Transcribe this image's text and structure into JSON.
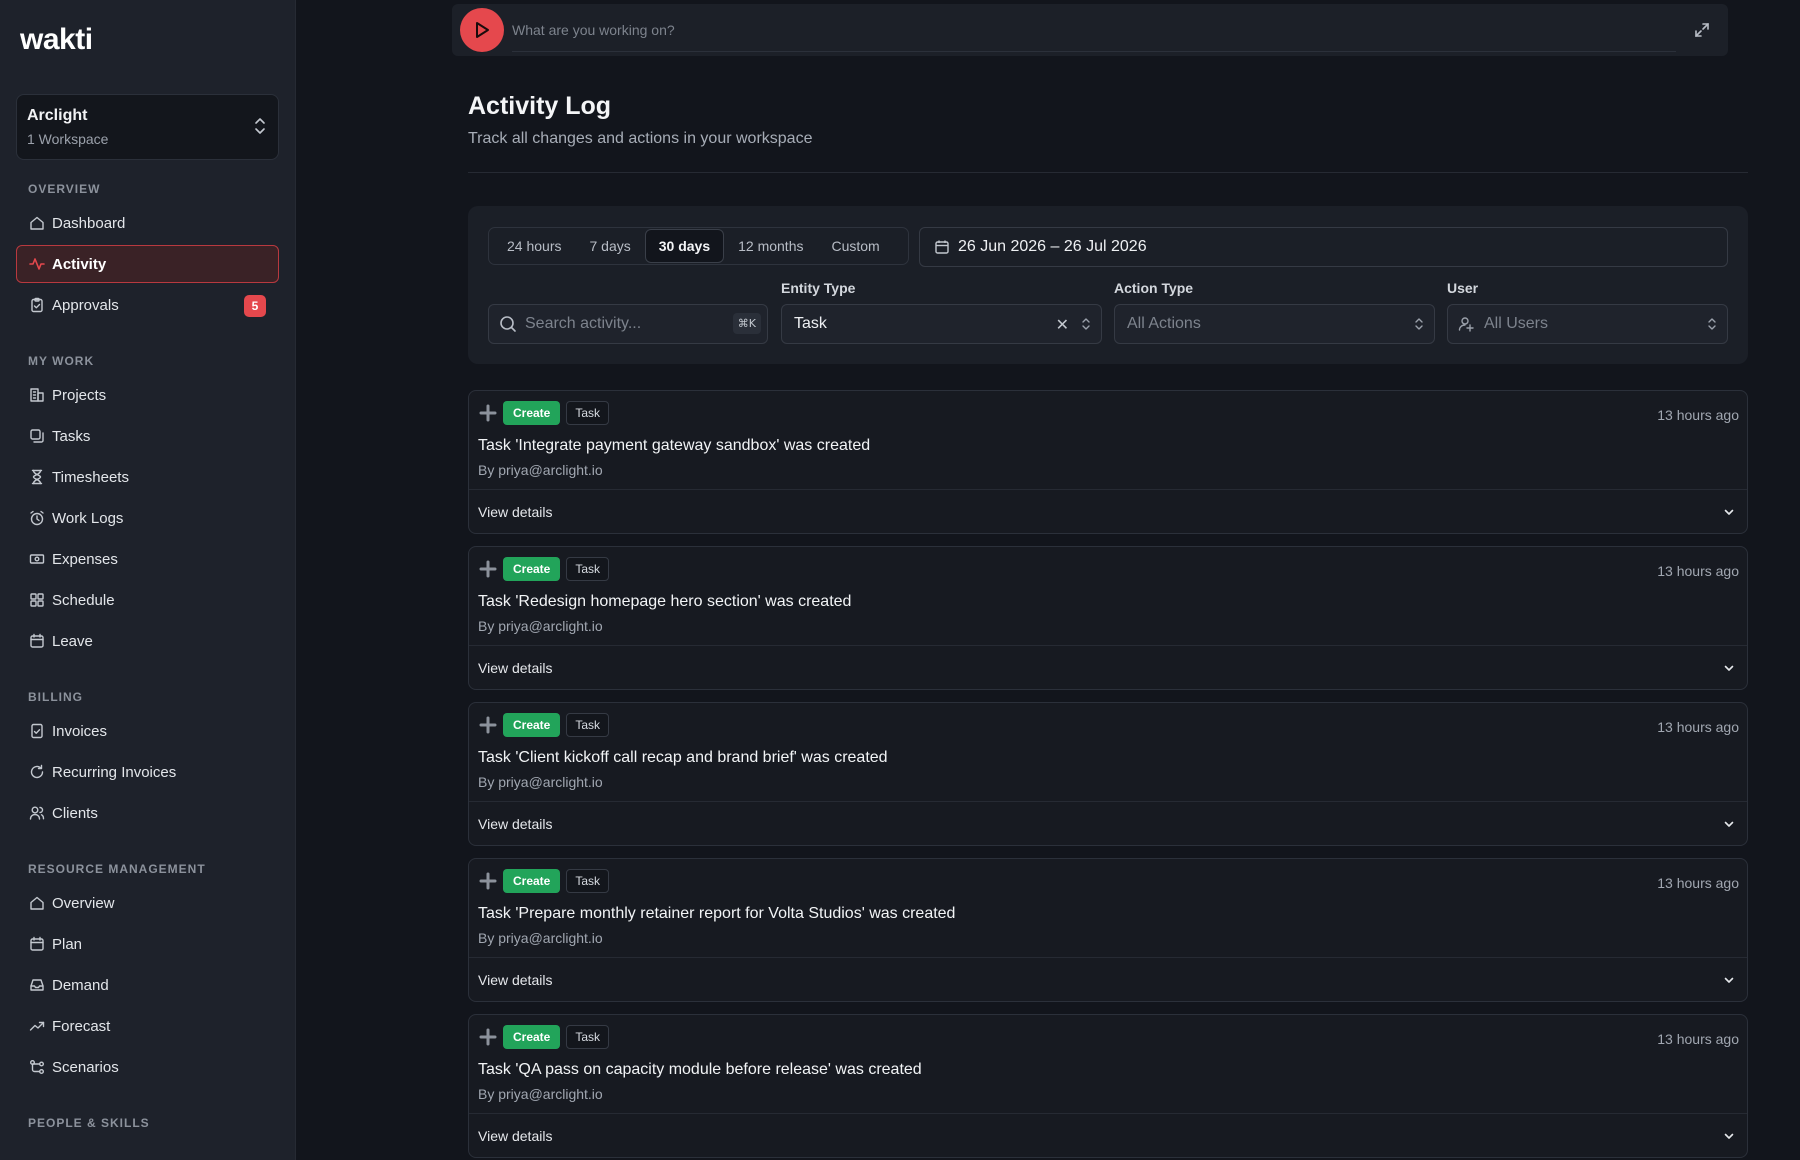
{
  "brand": {
    "name_main": "wakt",
    "name_accent": "i"
  },
  "workspace": {
    "name": "Arclight",
    "sub": "1 Workspace"
  },
  "sidebar": {
    "sections": [
      {
        "label": "OVERVIEW",
        "items": [
          {
            "label": "Dashboard",
            "icon": "home-icon"
          },
          {
            "label": "Activity",
            "icon": "activity-icon",
            "active": true
          },
          {
            "label": "Approvals",
            "icon": "clipboard-check-icon",
            "badge": "5"
          }
        ]
      },
      {
        "label": "MY WORK",
        "items": [
          {
            "label": "Projects",
            "icon": "building-icon"
          },
          {
            "label": "Tasks",
            "icon": "tasks-icon"
          },
          {
            "label": "Timesheets",
            "icon": "hourglass-icon"
          },
          {
            "label": "Work Logs",
            "icon": "alarm-clock-icon"
          },
          {
            "label": "Expenses",
            "icon": "banknote-icon"
          },
          {
            "label": "Schedule",
            "icon": "grid-icon"
          },
          {
            "label": "Leave",
            "icon": "calendar-icon"
          }
        ]
      },
      {
        "label": "BILLING",
        "items": [
          {
            "label": "Invoices",
            "icon": "invoice-icon"
          },
          {
            "label": "Recurring Invoices",
            "icon": "refresh-icon"
          },
          {
            "label": "Clients",
            "icon": "users-icon"
          }
        ]
      },
      {
        "label": "RESOURCE MANAGEMENT",
        "items": [
          {
            "label": "Overview",
            "icon": "home-icon"
          },
          {
            "label": "Plan",
            "icon": "calendar-icon"
          },
          {
            "label": "Demand",
            "icon": "inbox-icon"
          },
          {
            "label": "Forecast",
            "icon": "trend-up-icon"
          },
          {
            "label": "Scenarios",
            "icon": "branch-icon"
          }
        ]
      },
      {
        "label": "PEOPLE & SKILLS",
        "items": []
      }
    ]
  },
  "timer": {
    "placeholder": "What are you working on?"
  },
  "page": {
    "title": "Activity Log",
    "subtitle": "Track all changes and actions in your workspace"
  },
  "filters": {
    "ranges": [
      "24 hours",
      "7 days",
      "30 days",
      "12 months",
      "Custom"
    ],
    "active_range": "30 days",
    "date_range": "26 Jun 2026 – 26 Jul 2026",
    "search_placeholder": "Search activity...",
    "search_shortcut": "⌘K",
    "entity_label": "Entity Type",
    "entity_value": "Task",
    "action_label": "Action Type",
    "action_placeholder": "All Actions",
    "user_label": "User",
    "user_placeholder": "All Users"
  },
  "activities": [
    {
      "action": "Create",
      "entity": "Task",
      "time": "13 hours ago",
      "title": "Task 'Integrate payment gateway sandbox' was created",
      "by": "By priya@arclight.io",
      "details": "View details"
    },
    {
      "action": "Create",
      "entity": "Task",
      "time": "13 hours ago",
      "title": "Task 'Redesign homepage hero section' was created",
      "by": "By priya@arclight.io",
      "details": "View details"
    },
    {
      "action": "Create",
      "entity": "Task",
      "time": "13 hours ago",
      "title": "Task 'Client kickoff call recap and brand brief' was created",
      "by": "By priya@arclight.io",
      "details": "View details"
    },
    {
      "action": "Create",
      "entity": "Task",
      "time": "13 hours ago",
      "title": "Task 'Prepare monthly retainer report for Volta Studios' was created",
      "by": "By priya@arclight.io",
      "details": "View details"
    },
    {
      "action": "Create",
      "entity": "Task",
      "time": "13 hours ago",
      "title": "Task 'QA pass on capacity module before release' was created",
      "by": "By priya@arclight.io",
      "details": "View details"
    }
  ],
  "colors": {
    "accent": "#e5484d",
    "create_tag": "#22a45a",
    "sidebar_bg": "#1e222b",
    "page_bg": "#12151c"
  }
}
